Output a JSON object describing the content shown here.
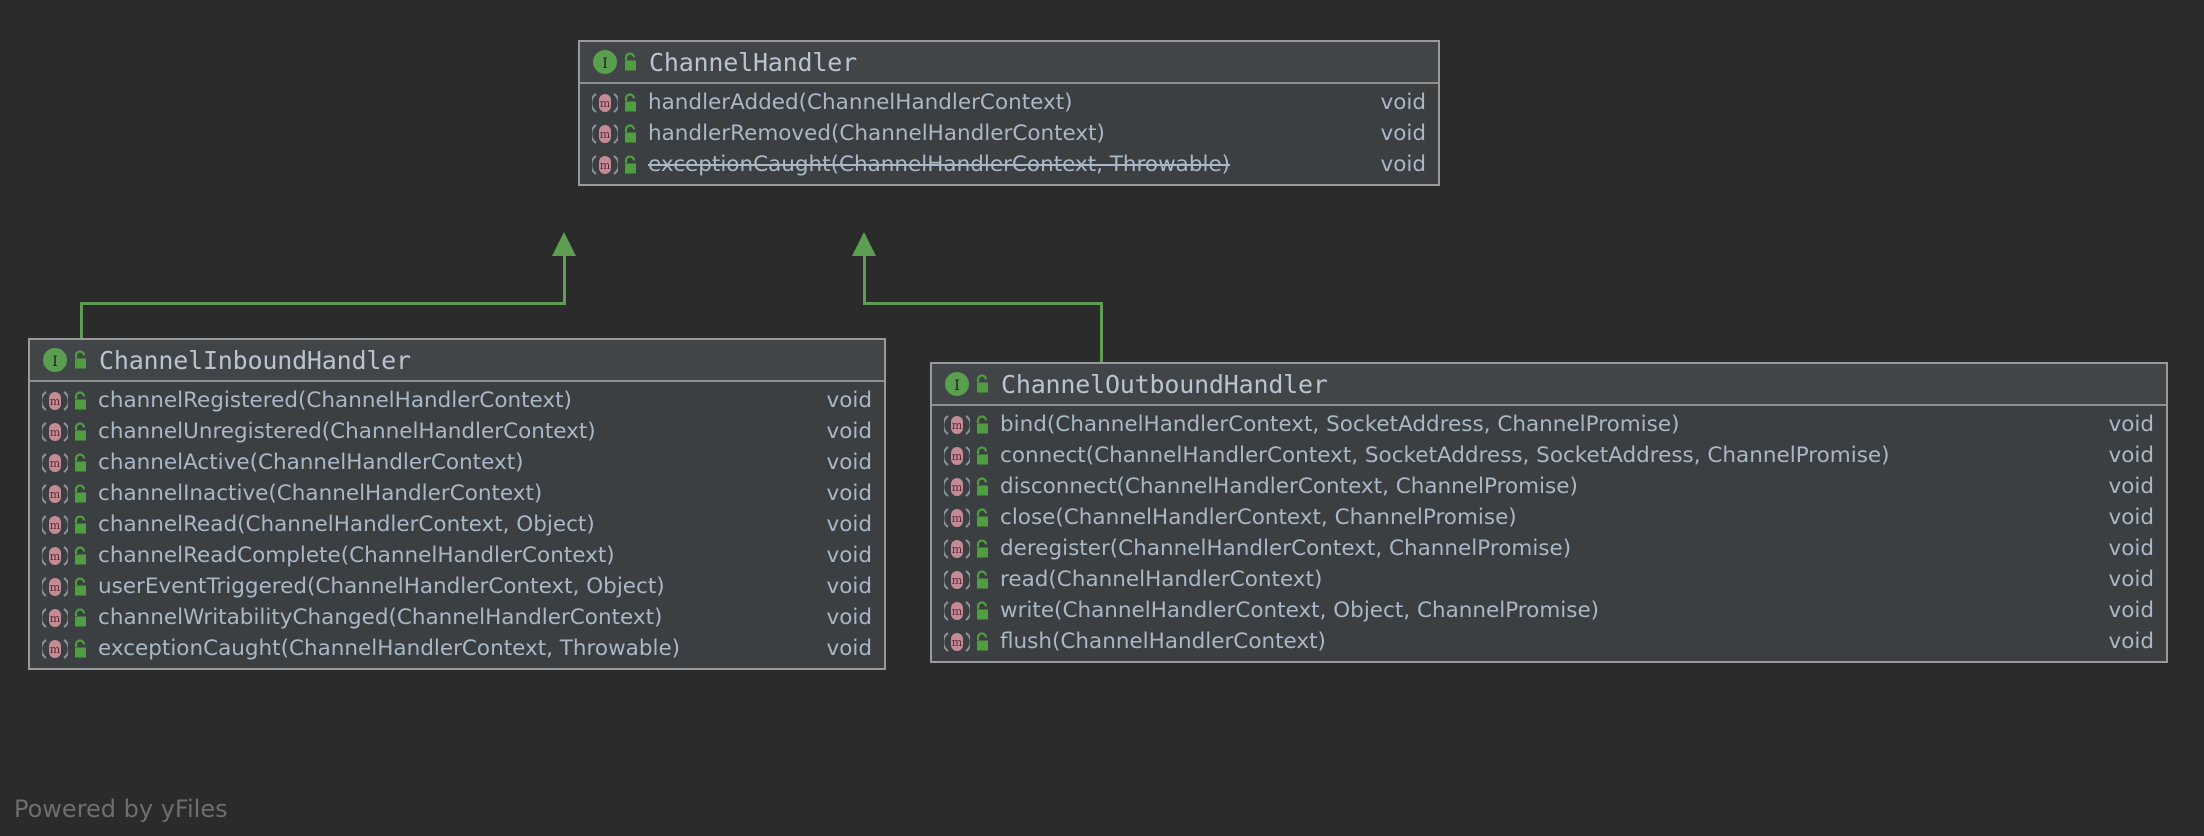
{
  "diagram": {
    "type": "uml-class-diagram",
    "watermark": "Powered by yFiles",
    "colors": {
      "background": "#2b2b2b",
      "class_fill": "#3c3f41",
      "class_header_fill": "#414548",
      "class_border": "#9a9a9a",
      "text": "#a9b7c6",
      "title_text": "#b9c4d0",
      "edge": "#5d9e52",
      "interface_icon": "#5a9e4f",
      "method_icon": "#c48a96",
      "lock_icon": "#4f9e3f",
      "watermark_text": "#6e6e6e"
    },
    "relationship_kind": "realization-inheritance"
  },
  "classes": [
    {
      "id": "channel-handler",
      "name": "ChannelHandler",
      "stereotype_icon": "interface-icon",
      "visibility_icon": "public-unlocked-icon",
      "members": [
        {
          "icon": "method-icon",
          "visibility_icon": "public-unlocked-icon",
          "signature": "handlerAdded(ChannelHandlerContext)",
          "type": "void",
          "deprecated": false
        },
        {
          "icon": "method-icon",
          "visibility_icon": "public-unlocked-icon",
          "signature": "handlerRemoved(ChannelHandlerContext)",
          "type": "void",
          "deprecated": false
        },
        {
          "icon": "method-icon",
          "visibility_icon": "public-unlocked-icon",
          "signature": "exceptionCaught(ChannelHandlerContext, Throwable)",
          "type": "void",
          "deprecated": true
        }
      ]
    },
    {
      "id": "channel-inbound-handler",
      "name": "ChannelInboundHandler",
      "stereotype_icon": "interface-icon",
      "visibility_icon": "public-unlocked-icon",
      "members": [
        {
          "icon": "method-icon",
          "visibility_icon": "public-unlocked-icon",
          "signature": "channelRegistered(ChannelHandlerContext)",
          "type": "void",
          "deprecated": false
        },
        {
          "icon": "method-icon",
          "visibility_icon": "public-unlocked-icon",
          "signature": "channelUnregistered(ChannelHandlerContext)",
          "type": "void",
          "deprecated": false
        },
        {
          "icon": "method-icon",
          "visibility_icon": "public-unlocked-icon",
          "signature": "channelActive(ChannelHandlerContext)",
          "type": "void",
          "deprecated": false
        },
        {
          "icon": "method-icon",
          "visibility_icon": "public-unlocked-icon",
          "signature": "channelInactive(ChannelHandlerContext)",
          "type": "void",
          "deprecated": false
        },
        {
          "icon": "method-icon",
          "visibility_icon": "public-unlocked-icon",
          "signature": "channelRead(ChannelHandlerContext, Object)",
          "type": "void",
          "deprecated": false
        },
        {
          "icon": "method-icon",
          "visibility_icon": "public-unlocked-icon",
          "signature": "channelReadComplete(ChannelHandlerContext)",
          "type": "void",
          "deprecated": false
        },
        {
          "icon": "method-icon",
          "visibility_icon": "public-unlocked-icon",
          "signature": "userEventTriggered(ChannelHandlerContext, Object)",
          "type": "void",
          "deprecated": false
        },
        {
          "icon": "method-icon",
          "visibility_icon": "public-unlocked-icon",
          "signature": "channelWritabilityChanged(ChannelHandlerContext)",
          "type": "void",
          "deprecated": false
        },
        {
          "icon": "method-icon",
          "visibility_icon": "public-unlocked-icon",
          "signature": "exceptionCaught(ChannelHandlerContext, Throwable)",
          "type": "void",
          "deprecated": false
        }
      ]
    },
    {
      "id": "channel-outbound-handler",
      "name": "ChannelOutboundHandler",
      "stereotype_icon": "interface-icon",
      "visibility_icon": "public-unlocked-icon",
      "members": [
        {
          "icon": "method-icon",
          "visibility_icon": "public-unlocked-icon",
          "signature": "bind(ChannelHandlerContext, SocketAddress, ChannelPromise)",
          "type": "void",
          "deprecated": false
        },
        {
          "icon": "method-icon",
          "visibility_icon": "public-unlocked-icon",
          "signature": "connect(ChannelHandlerContext, SocketAddress, SocketAddress, ChannelPromise)",
          "type": "void",
          "deprecated": false
        },
        {
          "icon": "method-icon",
          "visibility_icon": "public-unlocked-icon",
          "signature": "disconnect(ChannelHandlerContext, ChannelPromise)",
          "type": "void",
          "deprecated": false
        },
        {
          "icon": "method-icon",
          "visibility_icon": "public-unlocked-icon",
          "signature": "close(ChannelHandlerContext, ChannelPromise)",
          "type": "void",
          "deprecated": false
        },
        {
          "icon": "method-icon",
          "visibility_icon": "public-unlocked-icon",
          "signature": "deregister(ChannelHandlerContext, ChannelPromise)",
          "type": "void",
          "deprecated": false
        },
        {
          "icon": "method-icon",
          "visibility_icon": "public-unlocked-icon",
          "signature": "read(ChannelHandlerContext)",
          "type": "void",
          "deprecated": false
        },
        {
          "icon": "method-icon",
          "visibility_icon": "public-unlocked-icon",
          "signature": "write(ChannelHandlerContext, Object, ChannelPromise)",
          "type": "void",
          "deprecated": false
        },
        {
          "icon": "method-icon",
          "visibility_icon": "public-unlocked-icon",
          "signature": "flush(ChannelHandlerContext)",
          "type": "void",
          "deprecated": false
        }
      ]
    }
  ],
  "edges": [
    {
      "from": "channel-inbound-handler",
      "to": "channel-handler",
      "kind": "inheritance"
    },
    {
      "from": "channel-outbound-handler",
      "to": "channel-handler",
      "kind": "inheritance"
    }
  ]
}
